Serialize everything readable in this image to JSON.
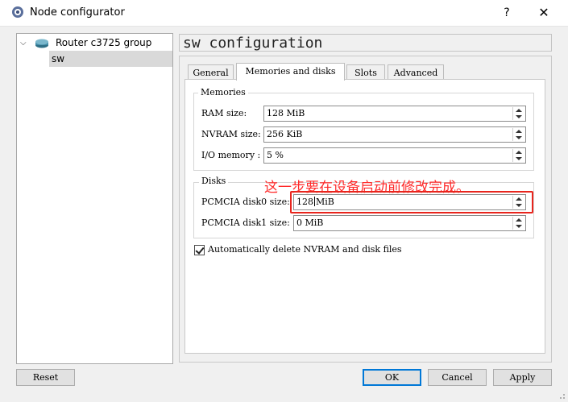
{
  "window": {
    "title": "Node configurator",
    "help_label": "?",
    "close_label": "✕"
  },
  "tree": {
    "parent_label": "Router c3725 group",
    "child_label": "sw"
  },
  "heading": "sw configuration",
  "tabs": [
    {
      "label": "General",
      "active": false
    },
    {
      "label": "Memories and disks",
      "active": true
    },
    {
      "label": "Slots",
      "active": false
    },
    {
      "label": "Advanced",
      "active": false
    }
  ],
  "memories": {
    "title": "Memories",
    "ram_label": "RAM size:",
    "ram_value": "128 MiB",
    "nvram_label": "NVRAM size:",
    "nvram_value": "256 KiB",
    "io_label": "I/O memory :",
    "io_value": "5 %"
  },
  "disks": {
    "title": "Disks",
    "disk0_label": "PCMCIA disk0 size:",
    "disk0_number": "128",
    "disk0_unit": "MiB",
    "disk1_label": "PCMCIA disk1 size:",
    "disk1_value": "0 MiB"
  },
  "annotation": {
    "text": "这一步要在设备启动前修改完成。",
    "color": "#ff2a2a"
  },
  "auto_delete": {
    "label": "Automatically delete NVRAM and disk files",
    "checked": true
  },
  "buttons": {
    "reset": "Reset",
    "ok": "OK",
    "cancel": "Cancel",
    "apply": "Apply"
  }
}
